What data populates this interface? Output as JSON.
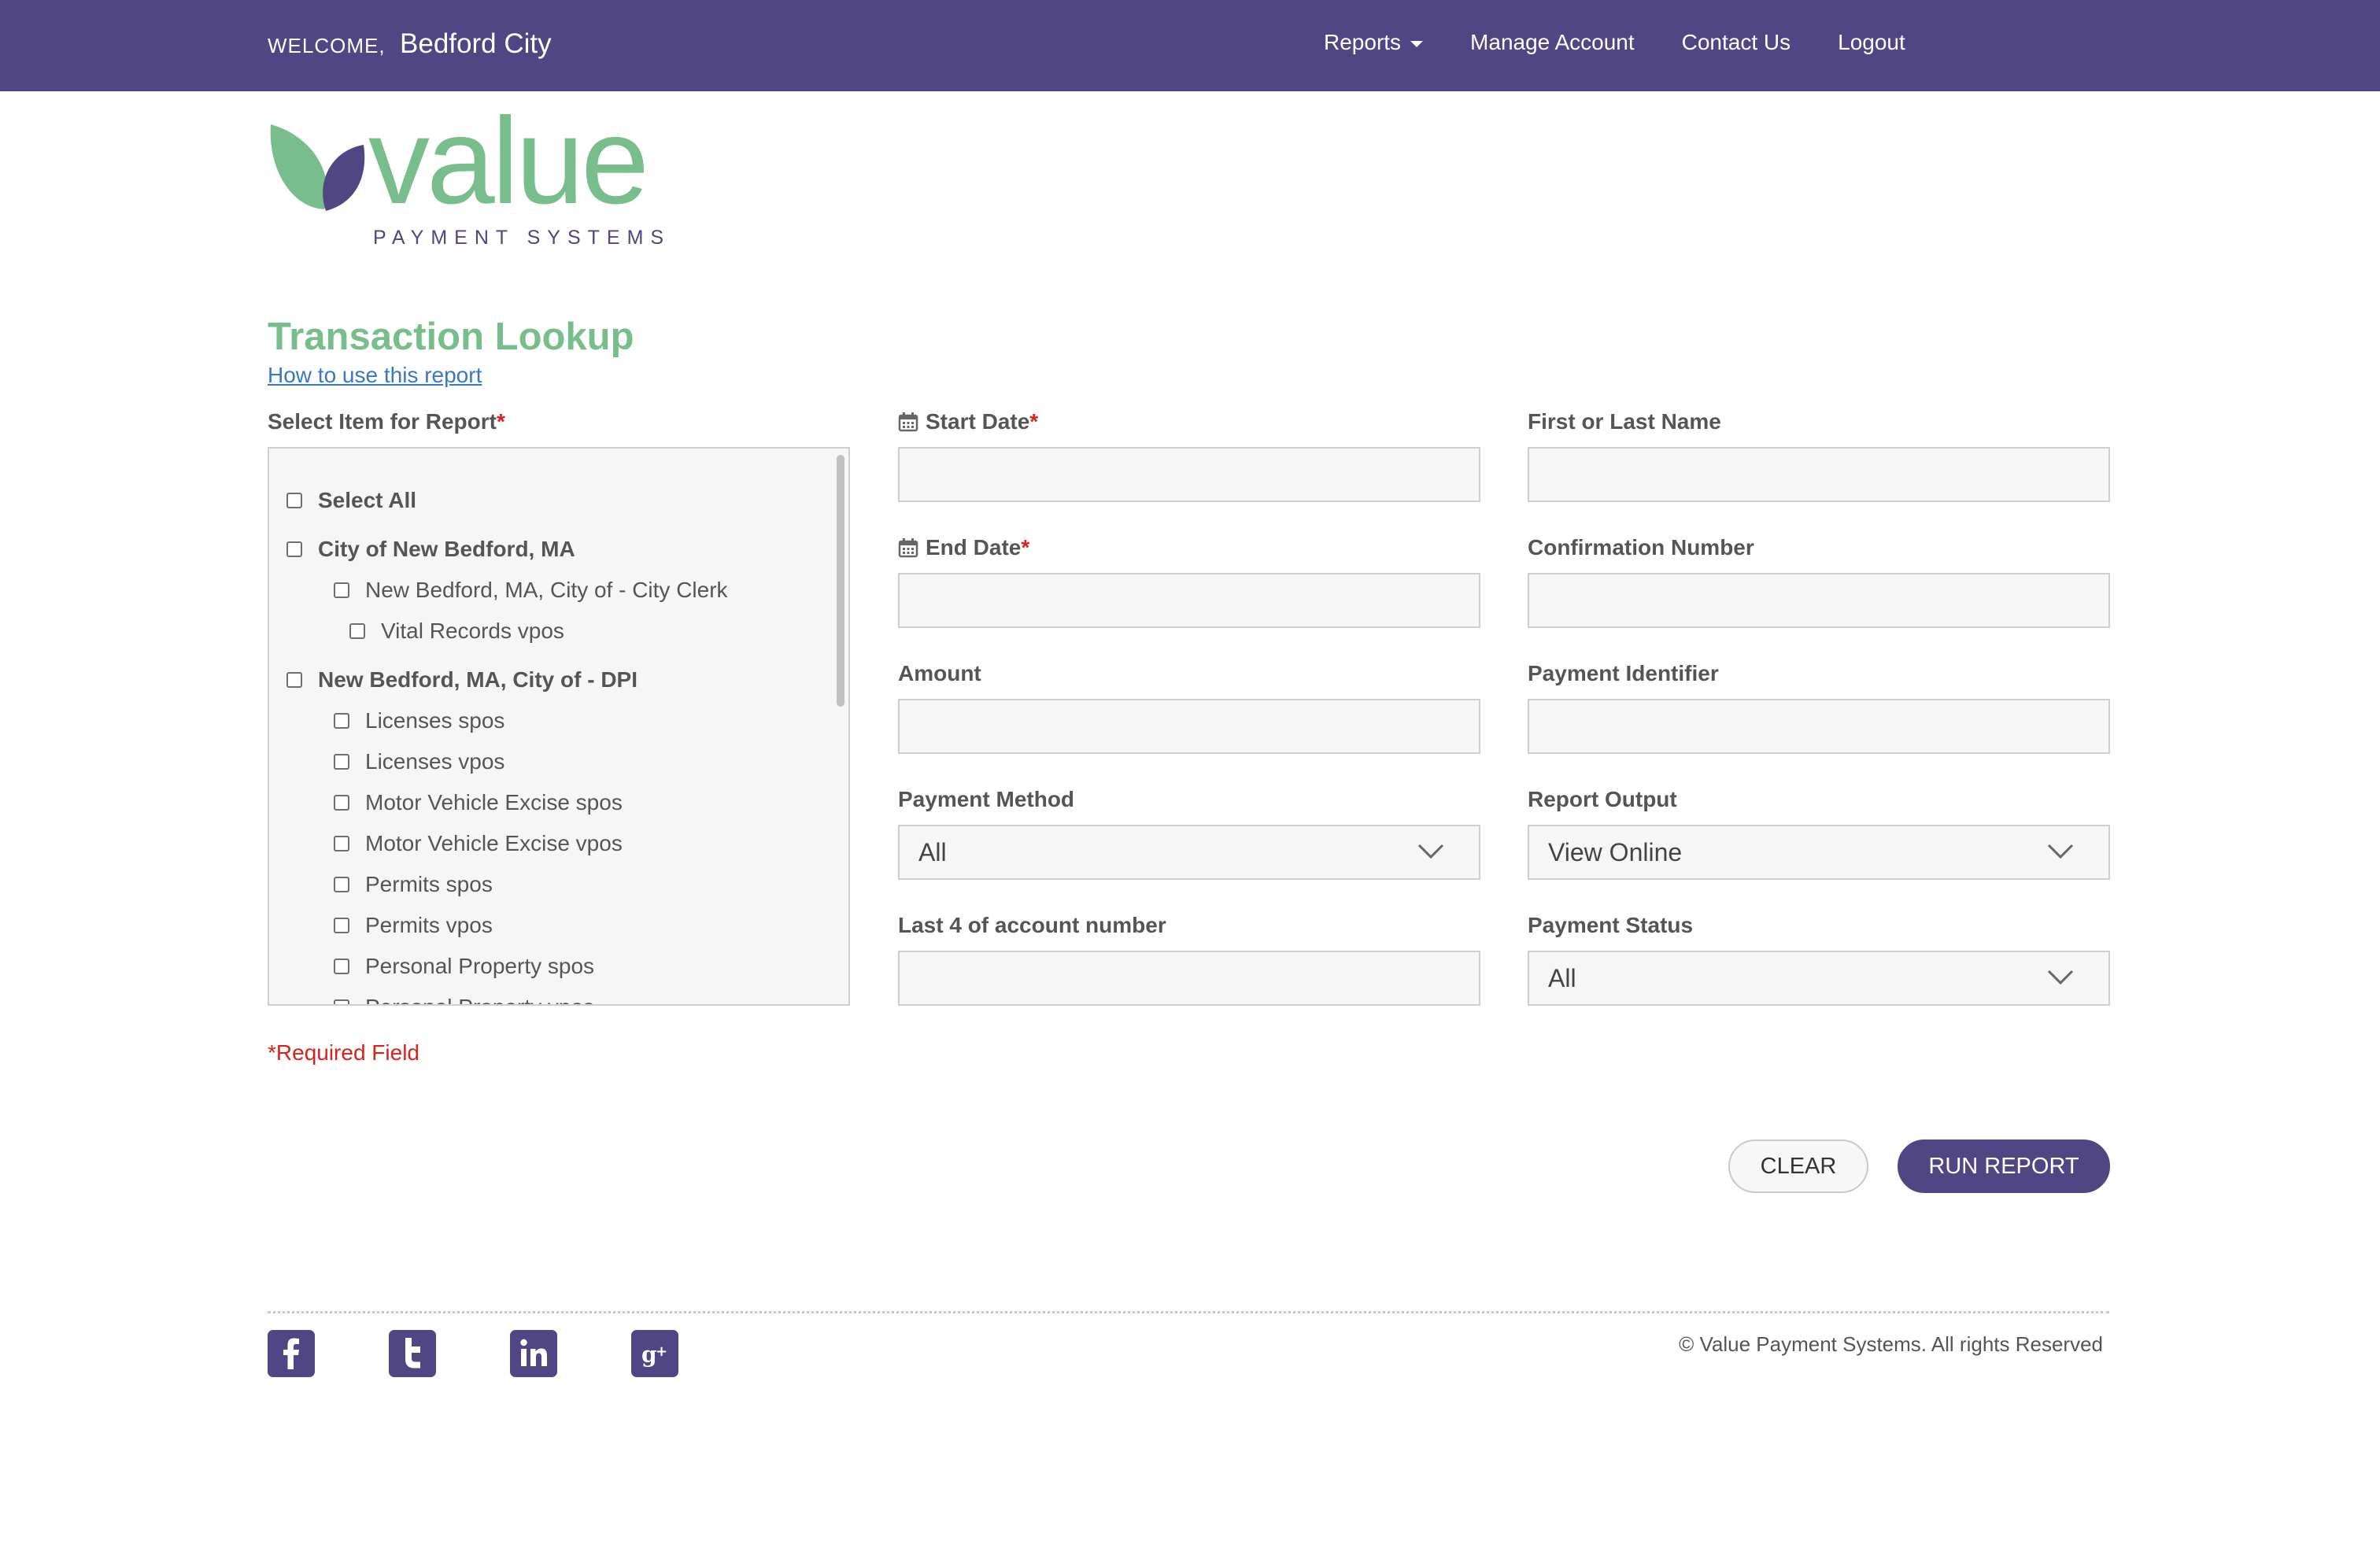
{
  "header": {
    "welcome_label": "WELCOME,",
    "user_name": "Bedford City",
    "nav": {
      "reports": "Reports",
      "manage_account": "Manage Account",
      "contact_us": "Contact Us",
      "logout": "Logout"
    }
  },
  "brand": {
    "wordmark": "value",
    "tagline": "PAYMENT SYSTEMS",
    "colors": {
      "purple": "#4f4683",
      "green": "#78be8c",
      "required": "#d9221c",
      "link": "#3a78c3"
    }
  },
  "page": {
    "title": "Transaction Lookup",
    "help_link": "How to use this report"
  },
  "items_panel": {
    "label": "Select Item for Report",
    "required_mark": "*",
    "items": [
      {
        "label": "Select All",
        "level": 0
      },
      {
        "label": "City of New Bedford, MA",
        "level": 0
      },
      {
        "label": "New Bedford, MA, City of - City Clerk",
        "level": 1
      },
      {
        "label": "Vital Records vpos",
        "level": 2
      },
      {
        "label": "New Bedford, MA, City of - DPI",
        "level": 0
      },
      {
        "label": "Licenses spos",
        "level": 1
      },
      {
        "label": "Licenses vpos",
        "level": 1
      },
      {
        "label": "Motor Vehicle Excise spos",
        "level": 1
      },
      {
        "label": "Motor Vehicle Excise vpos",
        "level": 1
      },
      {
        "label": "Permits spos",
        "level": 1
      },
      {
        "label": "Permits vpos",
        "level": 1
      },
      {
        "label": "Personal Property spos",
        "level": 1
      },
      {
        "label": "Personal Property vpos",
        "level": 1
      }
    ]
  },
  "form": {
    "start_date": {
      "label": "Start Date",
      "required_mark": "*",
      "value": ""
    },
    "end_date": {
      "label": "End Date",
      "required_mark": "*",
      "value": ""
    },
    "amount": {
      "label": "Amount",
      "value": ""
    },
    "payment_method": {
      "label": "Payment Method",
      "selected": "All"
    },
    "last4": {
      "label": "Last 4 of account number",
      "value": ""
    },
    "name": {
      "label": "First or Last Name",
      "value": ""
    },
    "confirmation": {
      "label": "Confirmation Number",
      "value": ""
    },
    "payment_identifier": {
      "label": "Payment Identifier",
      "value": ""
    },
    "report_output": {
      "label": "Report Output",
      "selected": "View Online"
    },
    "payment_status": {
      "label": "Payment Status",
      "selected": "All"
    }
  },
  "required_note": "*Required Field",
  "buttons": {
    "clear": "CLEAR",
    "run": "RUN REPORT"
  },
  "footer": {
    "social": [
      "facebook-icon",
      "twitter-icon",
      "linkedin-icon",
      "google-plus-icon"
    ],
    "copyright": "© Value Payment Systems. All rights Reserved"
  }
}
